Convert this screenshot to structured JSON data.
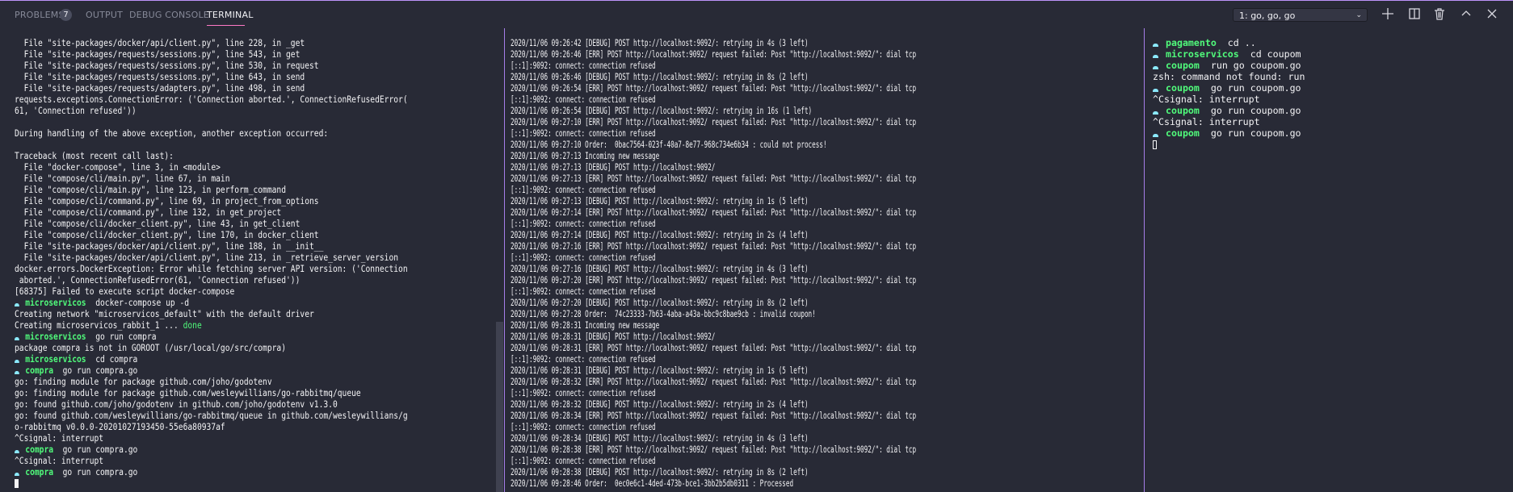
{
  "panel": {
    "tabs": [
      {
        "label": "PROBLEMS",
        "badge": "7",
        "active": false
      },
      {
        "label": "OUTPUT",
        "active": false
      },
      {
        "label": "DEBUG CONSOLE",
        "active": false
      },
      {
        "label": "TERMINAL",
        "active": true
      }
    ],
    "terminal_select": {
      "value": "1: go, go, go"
    },
    "actions": [
      {
        "icon": "plus-icon",
        "label": "New Terminal"
      },
      {
        "icon": "split-icon",
        "label": "Split Terminal"
      },
      {
        "icon": "trash-icon",
        "label": "Kill Terminal"
      },
      {
        "icon": "chevron-up-icon",
        "label": "Maximize Panel"
      },
      {
        "icon": "close-icon",
        "label": "Close Panel"
      }
    ]
  },
  "colors": {
    "accent": "#bd93f9",
    "tab_underline": "#ff79c6",
    "prompt_dir": "#50fa7b",
    "prompt_icon": "#8be9fd",
    "background": "#282a36"
  },
  "terminals": [
    {
      "lines": [
        {
          "text": "  File \"site-packages/docker/api/client.py\", line 228, in _get"
        },
        {
          "text": "  File \"site-packages/requests/sessions.py\", line 543, in get"
        },
        {
          "text": "  File \"site-packages/requests/sessions.py\", line 530, in request"
        },
        {
          "text": "  File \"site-packages/requests/sessions.py\", line 643, in send"
        },
        {
          "text": "  File \"site-packages/requests/adapters.py\", line 498, in send"
        },
        {
          "text": "requests.exceptions.ConnectionError: ('Connection aborted.', ConnectionRefusedError("
        },
        {
          "text": "61, 'Connection refused'))"
        },
        {
          "text": ""
        },
        {
          "text": "During handling of the above exception, another exception occurred:"
        },
        {
          "text": ""
        },
        {
          "text": "Traceback (most recent call last):"
        },
        {
          "text": "  File \"docker-compose\", line 3, in <module>"
        },
        {
          "text": "  File \"compose/cli/main.py\", line 67, in main"
        },
        {
          "text": "  File \"compose/cli/main.py\", line 123, in perform_command"
        },
        {
          "text": "  File \"compose/cli/command.py\", line 69, in project_from_options"
        },
        {
          "text": "  File \"compose/cli/command.py\", line 132, in get_project"
        },
        {
          "text": "  File \"compose/cli/docker_client.py\", line 43, in get_client"
        },
        {
          "text": "  File \"compose/cli/docker_client.py\", line 170, in docker_client"
        },
        {
          "text": "  File \"site-packages/docker/api/client.py\", line 188, in __init__"
        },
        {
          "text": "  File \"site-packages/docker/api/client.py\", line 213, in _retrieve_server_version"
        },
        {
          "text": "docker.errors.DockerException: Error while fetching server API version: ('Connection"
        },
        {
          "text": " aborted.', ConnectionRefusedError(61, 'Connection refused'))"
        },
        {
          "text": "[68375] Failed to execute script docker-compose"
        },
        {
          "dir": "microservicos",
          "cmd": "docker-compose up -d"
        },
        {
          "text": "Creating network \"microservicos_default\" with the default driver"
        },
        {
          "text": "Creating microservicos_rabbit_1 ... ",
          "highlight": "done"
        },
        {
          "dir": "microservicos",
          "cmd": "go run compra"
        },
        {
          "text": "package compra is not in GOROOT (/usr/local/go/src/compra)"
        },
        {
          "dir": "microservicos",
          "cmd": "cd compra"
        },
        {
          "dir": "compra",
          "cmd": "go run compra.go"
        },
        {
          "text": "go: finding module for package github.com/joho/godotenv"
        },
        {
          "text": "go: finding module for package github.com/wesleywillians/go-rabbitmq/queue"
        },
        {
          "text": "go: found github.com/joho/godotenv in github.com/joho/godotenv v1.3.0"
        },
        {
          "text": "go: found github.com/wesleywillians/go-rabbitmq/queue in github.com/wesleywillians/g"
        },
        {
          "text": "o-rabbitmq v0.0.0-20201027193450-55e6a80937af"
        },
        {
          "text": "^Csignal: interrupt"
        },
        {
          "dir": "compra",
          "cmd": "go run compra.go"
        },
        {
          "text": "^Csignal: interrupt"
        },
        {
          "dir": "compra",
          "cmd": "go run compra.go"
        },
        {
          "cursor": "filled"
        }
      ]
    },
    {
      "lines": [
        {
          "text": "2020/11/06 09:26:42 [DEBUG] POST http://localhost:9092/: retrying in 4s (3 left)"
        },
        {
          "text": "2020/11/06 09:26:46 [ERR] POST http://localhost:9092/ request failed: Post \"http://localhost:9092/\": dial tcp"
        },
        {
          "text": "[::1]:9092: connect: connection refused"
        },
        {
          "text": "2020/11/06 09:26:46 [DEBUG] POST http://localhost:9092/: retrying in 8s (2 left)"
        },
        {
          "text": "2020/11/06 09:26:54 [ERR] POST http://localhost:9092/ request failed: Post \"http://localhost:9092/\": dial tcp"
        },
        {
          "text": "[::1]:9092: connect: connection refused"
        },
        {
          "text": "2020/11/06 09:26:54 [DEBUG] POST http://localhost:9092/: retrying in 16s (1 left)"
        },
        {
          "text": "2020/11/06 09:27:10 [ERR] POST http://localhost:9092/ request failed: Post \"http://localhost:9092/\": dial tcp"
        },
        {
          "text": "[::1]:9092: connect: connection refused"
        },
        {
          "text": "2020/11/06 09:27:10 Order:  0bac7564-023f-40a7-8e77-968c734e6b34 : could not process!"
        },
        {
          "text": "2020/11/06 09:27:13 Incoming new message"
        },
        {
          "text": "2020/11/06 09:27:13 [DEBUG] POST http://localhost:9092/"
        },
        {
          "text": "2020/11/06 09:27:13 [ERR] POST http://localhost:9092/ request failed: Post \"http://localhost:9092/\": dial tcp"
        },
        {
          "text": "[::1]:9092: connect: connection refused"
        },
        {
          "text": "2020/11/06 09:27:13 [DEBUG] POST http://localhost:9092/: retrying in 1s (5 left)"
        },
        {
          "text": "2020/11/06 09:27:14 [ERR] POST http://localhost:9092/ request failed: Post \"http://localhost:9092/\": dial tcp"
        },
        {
          "text": "[::1]:9092: connect: connection refused"
        },
        {
          "text": "2020/11/06 09:27:14 [DEBUG] POST http://localhost:9092/: retrying in 2s (4 left)"
        },
        {
          "text": "2020/11/06 09:27:16 [ERR] POST http://localhost:9092/ request failed: Post \"http://localhost:9092/\": dial tcp"
        },
        {
          "text": "[::1]:9092: connect: connection refused"
        },
        {
          "text": "2020/11/06 09:27:16 [DEBUG] POST http://localhost:9092/: retrying in 4s (3 left)"
        },
        {
          "text": "2020/11/06 09:27:20 [ERR] POST http://localhost:9092/ request failed: Post \"http://localhost:9092/\": dial tcp"
        },
        {
          "text": "[::1]:9092: connect: connection refused"
        },
        {
          "text": "2020/11/06 09:27:20 [DEBUG] POST http://localhost:9092/: retrying in 8s (2 left)"
        },
        {
          "text": "2020/11/06 09:27:28 Order:  74c23333-7b63-4aba-a43a-bbc9c8bae9cb : invalid coupon!"
        },
        {
          "text": "2020/11/06 09:28:31 Incoming new message"
        },
        {
          "text": "2020/11/06 09:28:31 [DEBUG] POST http://localhost:9092/"
        },
        {
          "text": "2020/11/06 09:28:31 [ERR] POST http://localhost:9092/ request failed: Post \"http://localhost:9092/\": dial tcp"
        },
        {
          "text": "[::1]:9092: connect: connection refused"
        },
        {
          "text": "2020/11/06 09:28:31 [DEBUG] POST http://localhost:9092/: retrying in 1s (5 left)"
        },
        {
          "text": "2020/11/06 09:28:32 [ERR] POST http://localhost:9092/ request failed: Post \"http://localhost:9092/\": dial tcp"
        },
        {
          "text": "[::1]:9092: connect: connection refused"
        },
        {
          "text": "2020/11/06 09:28:32 [DEBUG] POST http://localhost:9092/: retrying in 2s (4 left)"
        },
        {
          "text": "2020/11/06 09:28:34 [ERR] POST http://localhost:9092/ request failed: Post \"http://localhost:9092/\": dial tcp"
        },
        {
          "text": "[::1]:9092: connect: connection refused"
        },
        {
          "text": "2020/11/06 09:28:34 [DEBUG] POST http://localhost:9092/: retrying in 4s (3 left)"
        },
        {
          "text": "2020/11/06 09:28:38 [ERR] POST http://localhost:9092/ request failed: Post \"http://localhost:9092/\": dial tcp"
        },
        {
          "text": "[::1]:9092: connect: connection refused"
        },
        {
          "text": "2020/11/06 09:28:38 [DEBUG] POST http://localhost:9092/: retrying in 8s (2 left)"
        },
        {
          "text": "2020/11/06 09:28:46 Order:  0ec0e6c1-4ded-473b-bce1-3bb2b5db0311 : Processed"
        }
      ]
    },
    {
      "lines": [
        {
          "dir": "pagamento",
          "cmd": "cd .."
        },
        {
          "dir": "microservicos",
          "cmd": "cd coupom"
        },
        {
          "dir": "coupom",
          "cmd": "run go coupom.go"
        },
        {
          "text": "zsh: command not found: run"
        },
        {
          "dir": "coupom",
          "cmd": "go run coupom.go"
        },
        {
          "text": "^Csignal: interrupt"
        },
        {
          "dir": "coupom",
          "cmd": "go run coupom.go"
        },
        {
          "text": "^Csignal: interrupt"
        },
        {
          "dir": "coupom",
          "cmd": "go run coupom.go"
        },
        {
          "cursor": "hollow"
        }
      ]
    }
  ]
}
